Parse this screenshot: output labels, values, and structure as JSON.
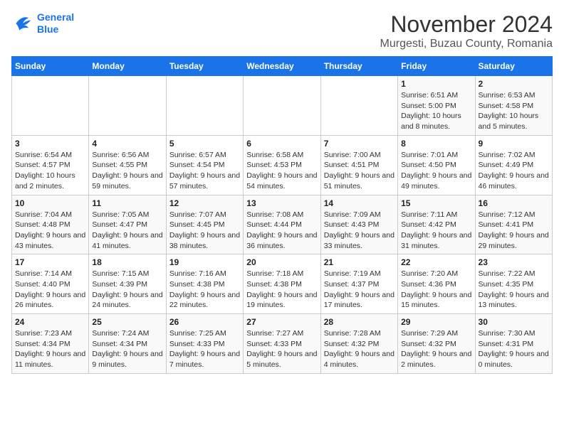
{
  "header": {
    "logo_line1": "General",
    "logo_line2": "Blue",
    "month_title": "November 2024",
    "location": "Murgesti, Buzau County, Romania"
  },
  "days_of_week": [
    "Sunday",
    "Monday",
    "Tuesday",
    "Wednesday",
    "Thursday",
    "Friday",
    "Saturday"
  ],
  "weeks": [
    [
      {
        "day": "",
        "sunrise": "",
        "sunset": "",
        "daylight": ""
      },
      {
        "day": "",
        "sunrise": "",
        "sunset": "",
        "daylight": ""
      },
      {
        "day": "",
        "sunrise": "",
        "sunset": "",
        "daylight": ""
      },
      {
        "day": "",
        "sunrise": "",
        "sunset": "",
        "daylight": ""
      },
      {
        "day": "",
        "sunrise": "",
        "sunset": "",
        "daylight": ""
      },
      {
        "day": "1",
        "sunrise": "Sunrise: 6:51 AM",
        "sunset": "Sunset: 5:00 PM",
        "daylight": "Daylight: 10 hours and 8 minutes."
      },
      {
        "day": "2",
        "sunrise": "Sunrise: 6:53 AM",
        "sunset": "Sunset: 4:58 PM",
        "daylight": "Daylight: 10 hours and 5 minutes."
      }
    ],
    [
      {
        "day": "3",
        "sunrise": "Sunrise: 6:54 AM",
        "sunset": "Sunset: 4:57 PM",
        "daylight": "Daylight: 10 hours and 2 minutes."
      },
      {
        "day": "4",
        "sunrise": "Sunrise: 6:56 AM",
        "sunset": "Sunset: 4:55 PM",
        "daylight": "Daylight: 9 hours and 59 minutes."
      },
      {
        "day": "5",
        "sunrise": "Sunrise: 6:57 AM",
        "sunset": "Sunset: 4:54 PM",
        "daylight": "Daylight: 9 hours and 57 minutes."
      },
      {
        "day": "6",
        "sunrise": "Sunrise: 6:58 AM",
        "sunset": "Sunset: 4:53 PM",
        "daylight": "Daylight: 9 hours and 54 minutes."
      },
      {
        "day": "7",
        "sunrise": "Sunrise: 7:00 AM",
        "sunset": "Sunset: 4:51 PM",
        "daylight": "Daylight: 9 hours and 51 minutes."
      },
      {
        "day": "8",
        "sunrise": "Sunrise: 7:01 AM",
        "sunset": "Sunset: 4:50 PM",
        "daylight": "Daylight: 9 hours and 49 minutes."
      },
      {
        "day": "9",
        "sunrise": "Sunrise: 7:02 AM",
        "sunset": "Sunset: 4:49 PM",
        "daylight": "Daylight: 9 hours and 46 minutes."
      }
    ],
    [
      {
        "day": "10",
        "sunrise": "Sunrise: 7:04 AM",
        "sunset": "Sunset: 4:48 PM",
        "daylight": "Daylight: 9 hours and 43 minutes."
      },
      {
        "day": "11",
        "sunrise": "Sunrise: 7:05 AM",
        "sunset": "Sunset: 4:47 PM",
        "daylight": "Daylight: 9 hours and 41 minutes."
      },
      {
        "day": "12",
        "sunrise": "Sunrise: 7:07 AM",
        "sunset": "Sunset: 4:45 PM",
        "daylight": "Daylight: 9 hours and 38 minutes."
      },
      {
        "day": "13",
        "sunrise": "Sunrise: 7:08 AM",
        "sunset": "Sunset: 4:44 PM",
        "daylight": "Daylight: 9 hours and 36 minutes."
      },
      {
        "day": "14",
        "sunrise": "Sunrise: 7:09 AM",
        "sunset": "Sunset: 4:43 PM",
        "daylight": "Daylight: 9 hours and 33 minutes."
      },
      {
        "day": "15",
        "sunrise": "Sunrise: 7:11 AM",
        "sunset": "Sunset: 4:42 PM",
        "daylight": "Daylight: 9 hours and 31 minutes."
      },
      {
        "day": "16",
        "sunrise": "Sunrise: 7:12 AM",
        "sunset": "Sunset: 4:41 PM",
        "daylight": "Daylight: 9 hours and 29 minutes."
      }
    ],
    [
      {
        "day": "17",
        "sunrise": "Sunrise: 7:14 AM",
        "sunset": "Sunset: 4:40 PM",
        "daylight": "Daylight: 9 hours and 26 minutes."
      },
      {
        "day": "18",
        "sunrise": "Sunrise: 7:15 AM",
        "sunset": "Sunset: 4:39 PM",
        "daylight": "Daylight: 9 hours and 24 minutes."
      },
      {
        "day": "19",
        "sunrise": "Sunrise: 7:16 AM",
        "sunset": "Sunset: 4:38 PM",
        "daylight": "Daylight: 9 hours and 22 minutes."
      },
      {
        "day": "20",
        "sunrise": "Sunrise: 7:18 AM",
        "sunset": "Sunset: 4:38 PM",
        "daylight": "Daylight: 9 hours and 19 minutes."
      },
      {
        "day": "21",
        "sunrise": "Sunrise: 7:19 AM",
        "sunset": "Sunset: 4:37 PM",
        "daylight": "Daylight: 9 hours and 17 minutes."
      },
      {
        "day": "22",
        "sunrise": "Sunrise: 7:20 AM",
        "sunset": "Sunset: 4:36 PM",
        "daylight": "Daylight: 9 hours and 15 minutes."
      },
      {
        "day": "23",
        "sunrise": "Sunrise: 7:22 AM",
        "sunset": "Sunset: 4:35 PM",
        "daylight": "Daylight: 9 hours and 13 minutes."
      }
    ],
    [
      {
        "day": "24",
        "sunrise": "Sunrise: 7:23 AM",
        "sunset": "Sunset: 4:34 PM",
        "daylight": "Daylight: 9 hours and 11 minutes."
      },
      {
        "day": "25",
        "sunrise": "Sunrise: 7:24 AM",
        "sunset": "Sunset: 4:34 PM",
        "daylight": "Daylight: 9 hours and 9 minutes."
      },
      {
        "day": "26",
        "sunrise": "Sunrise: 7:25 AM",
        "sunset": "Sunset: 4:33 PM",
        "daylight": "Daylight: 9 hours and 7 minutes."
      },
      {
        "day": "27",
        "sunrise": "Sunrise: 7:27 AM",
        "sunset": "Sunset: 4:33 PM",
        "daylight": "Daylight: 9 hours and 5 minutes."
      },
      {
        "day": "28",
        "sunrise": "Sunrise: 7:28 AM",
        "sunset": "Sunset: 4:32 PM",
        "daylight": "Daylight: 9 hours and 4 minutes."
      },
      {
        "day": "29",
        "sunrise": "Sunrise: 7:29 AM",
        "sunset": "Sunset: 4:32 PM",
        "daylight": "Daylight: 9 hours and 2 minutes."
      },
      {
        "day": "30",
        "sunrise": "Sunrise: 7:30 AM",
        "sunset": "Sunset: 4:31 PM",
        "daylight": "Daylight: 9 hours and 0 minutes."
      }
    ]
  ]
}
